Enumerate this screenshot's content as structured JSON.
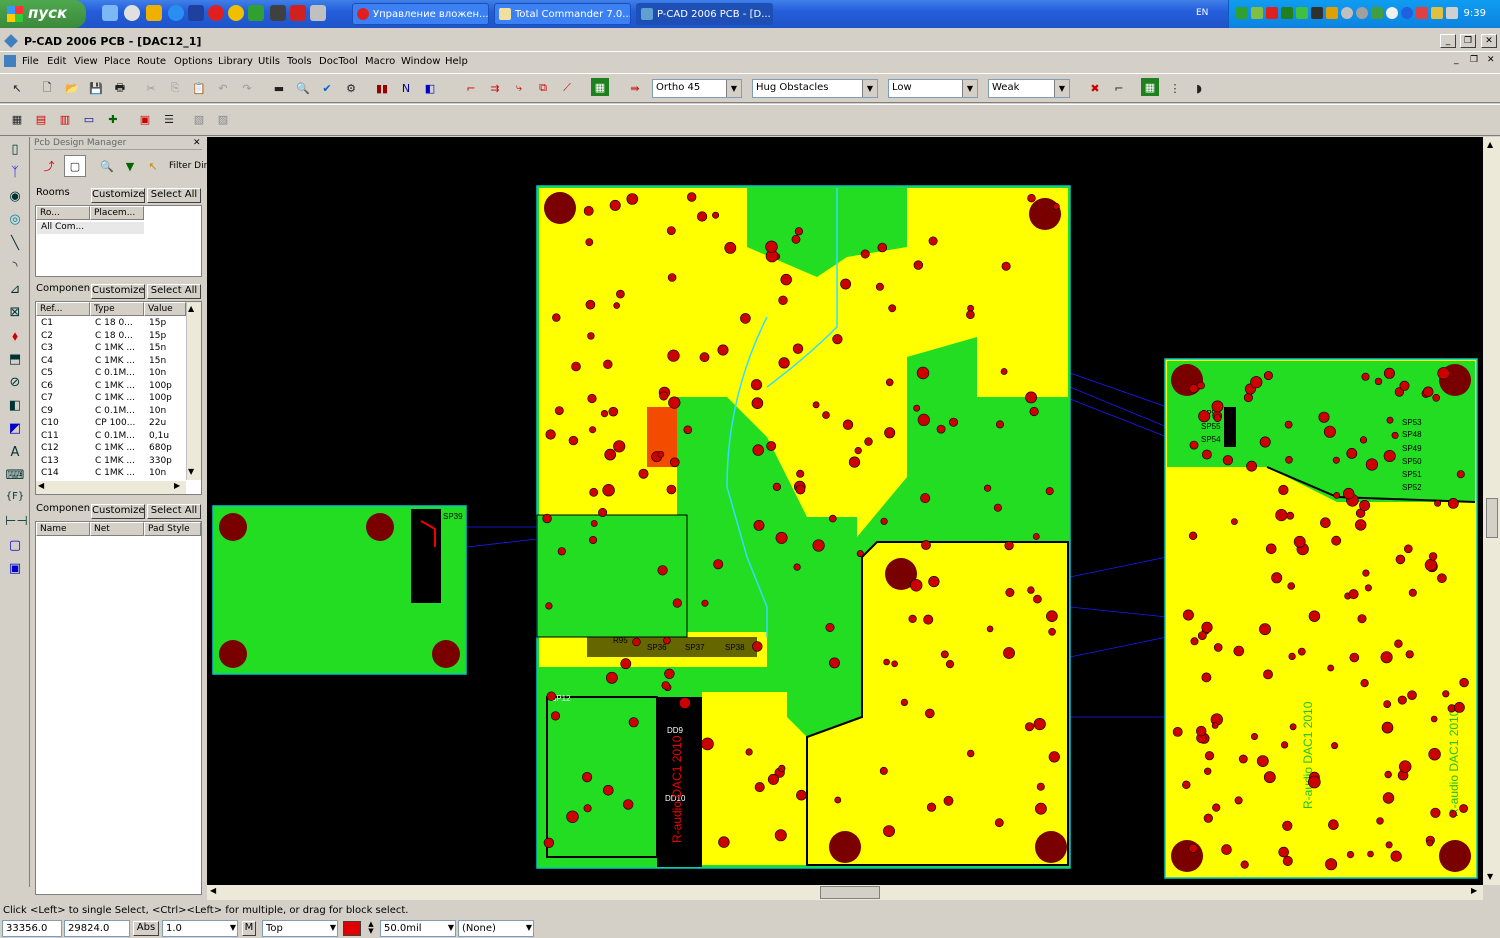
{
  "taskbar": {
    "start_label": "пуск",
    "tasks": [
      {
        "label": "Управление вложен..."
      },
      {
        "label": "Total Commander 7.0..."
      },
      {
        "label": "P-CAD 2006 PCB - [D..."
      }
    ],
    "lang": "EN",
    "clock": "9:39"
  },
  "window": {
    "title": "P-CAD 2006 PCB - [DAC12_1]"
  },
  "menu": [
    "File",
    "Edit",
    "View",
    "Place",
    "Route",
    "Options",
    "Library",
    "Utils",
    "Tools",
    "DocTool",
    "Macro",
    "Window",
    "Help"
  ],
  "toolbar": {
    "ortho": "Ortho 45",
    "obstacles": "Hug Obstacles",
    "level": "Low",
    "strength": "Weak"
  },
  "panel": {
    "title": "Pcb Design Manager",
    "filter_label": "Filter Dir",
    "customize_label": "Customize",
    "select_all_label": "Select All",
    "rooms": {
      "label": "Rooms",
      "headers": [
        "Ro...",
        "Placem..."
      ],
      "rows": [
        "All Com..."
      ]
    },
    "components": {
      "label": "Componen",
      "headers": [
        "Ref...",
        "Type",
        "Value"
      ],
      "rows": [
        {
          "ref": "C1",
          "type": "C 18 0...",
          "value": "15p"
        },
        {
          "ref": "C2",
          "type": "C 18 0...",
          "value": "15p"
        },
        {
          "ref": "C3",
          "type": "C 1MK ...",
          "value": "15n"
        },
        {
          "ref": "C4",
          "type": "C 1MK ...",
          "value": "15n"
        },
        {
          "ref": "C5",
          "type": "C 0.1M...",
          "value": "10n"
        },
        {
          "ref": "C6",
          "type": "C 1MK ...",
          "value": "100p"
        },
        {
          "ref": "C7",
          "type": "C 1MK ...",
          "value": "100p"
        },
        {
          "ref": "C9",
          "type": "C 0.1M...",
          "value": "10n"
        },
        {
          "ref": "C10",
          "type": "CP 100...",
          "value": "22u"
        },
        {
          "ref": "C11",
          "type": "C 0.1M...",
          "value": "0,1u"
        },
        {
          "ref": "C12",
          "type": "C 1MK ...",
          "value": "680p"
        },
        {
          "ref": "C13",
          "type": "C 1MK ...",
          "value": "330p"
        },
        {
          "ref": "C14",
          "type": "C 1MK ...",
          "value": "10n"
        }
      ]
    },
    "pads": {
      "label": "Componen",
      "headers": [
        "Name",
        "Net",
        "Pad Style"
      ]
    }
  },
  "board_labels": {
    "left_top": "SP39",
    "sp37": "SP37",
    "sp38": "SP38",
    "sp36": "SP36",
    "sp12": "SP12",
    "r95": "R95",
    "dd9": "DD9",
    "dd10": "DD10",
    "vertical1": "R-audio DAC1 2010",
    "vertical2": "R-audio DAC1 2010",
    "vertical3": "R-audio DAC1 2010",
    "sp53": "SP53",
    "sp48": "SP48",
    "sp49": "SP49",
    "sp50": "SP50",
    "sp51": "SP51",
    "sp52": "SP52",
    "sp58": "SP58",
    "sp55": "SP55",
    "sp54": "SP54"
  },
  "status": {
    "hint": "Click <Left> to single Select, <Ctrl><Left> for multiple, or drag for block select.",
    "x": "33356.0",
    "y": "29824.0",
    "abs": "Abs",
    "grid": "1.0",
    "m": "M",
    "layer": "Top",
    "width": "50.0mil",
    "net": "(None)"
  },
  "colors": {
    "board_yellow": "#ffff00",
    "board_green": "#22dd22",
    "pad_red": "#cc0000",
    "hole_dark": "#7a0000",
    "outline": "#00c8c8",
    "taskbar_blue": "#245edb"
  }
}
